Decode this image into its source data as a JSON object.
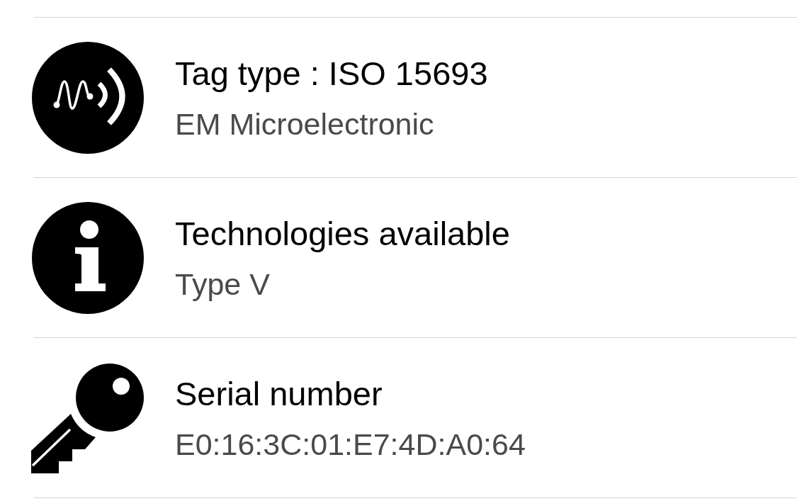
{
  "items": [
    {
      "kind": "tag",
      "title": "Tag type : ISO 15693",
      "subtitle": "EM Microelectronic"
    },
    {
      "kind": "technology",
      "title": "Technologies available",
      "subtitle": "Type V"
    },
    {
      "kind": "serial",
      "title": "Serial number",
      "subtitle": "E0:16:3C:01:E7:4D:A0:64"
    }
  ]
}
